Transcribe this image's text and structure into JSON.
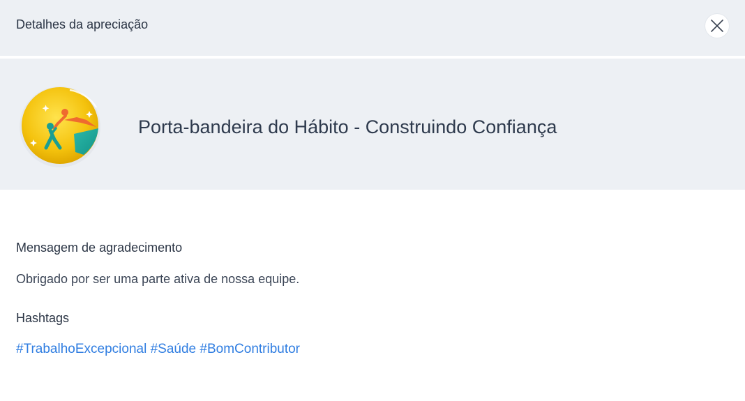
{
  "header": {
    "title": "Detalhes da apreciação"
  },
  "banner": {
    "badge_icon": "climbing-help-badge-icon",
    "title": "Porta-bandeira do Hábito - Construindo Confiança"
  },
  "message": {
    "label": "Mensagem de agradecimento",
    "text": "Obrigado por ser uma parte ativa de nossa equipe."
  },
  "hashtags": {
    "label": "Hashtags",
    "items": [
      "#TrabalhoExcepcional",
      "#Saúde",
      "#BomContributor"
    ]
  },
  "colors": {
    "header_bg": "#edf0f4",
    "hashtag": "#2f7de1",
    "text": "#2a3444"
  }
}
